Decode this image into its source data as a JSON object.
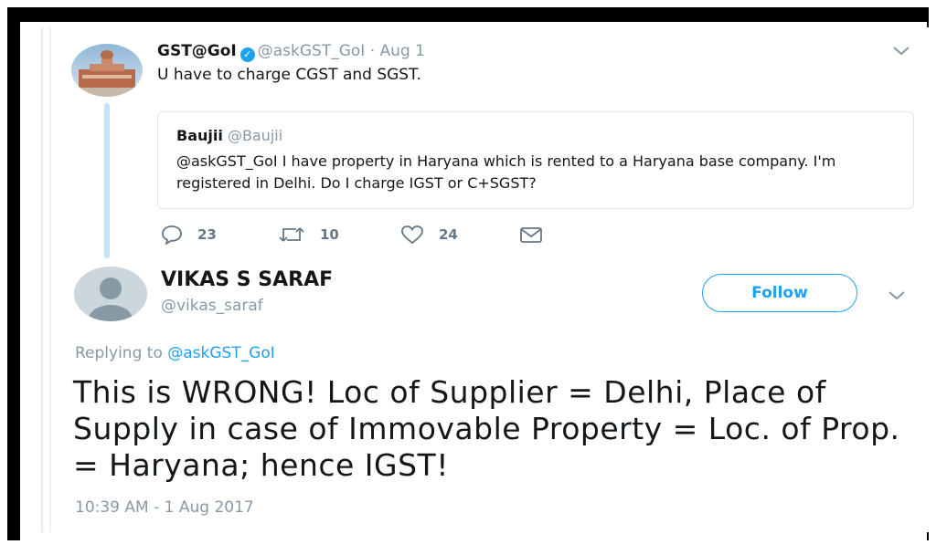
{
  "tweet1": {
    "name": "GST@GoI",
    "handle": "@askGST_GoI",
    "date": "· Aug 1",
    "text": "U have to charge CGST and SGST.",
    "quote": {
      "name": "Baujii",
      "handle": "@Baujii",
      "text": "@askGST_GoI I have property in Haryana which is rented to a Haryana base company. I'm registered in Delhi. Do I charge IGST or C+SGST?"
    },
    "actions": {
      "replies": "23",
      "retweets": "10",
      "likes": "24"
    }
  },
  "tweet2": {
    "name": "VIKAS S SARAF",
    "handle": "@vikas_saraf",
    "follow_label": "Follow",
    "replying_prefix": "Replying to",
    "replying_to": "@askGST_GoI",
    "text": "This is WRONG! Loc of Supplier = Delhi, Place of Supply in case of Immovable Property = Loc. of Prop. = Haryana; hence IGST!",
    "timestamp": "10:39 AM - 1 Aug 2017"
  },
  "colors": {
    "accent": "#1da1f2",
    "muted": "#8899a6",
    "thread_line": "#c4e3f6"
  }
}
